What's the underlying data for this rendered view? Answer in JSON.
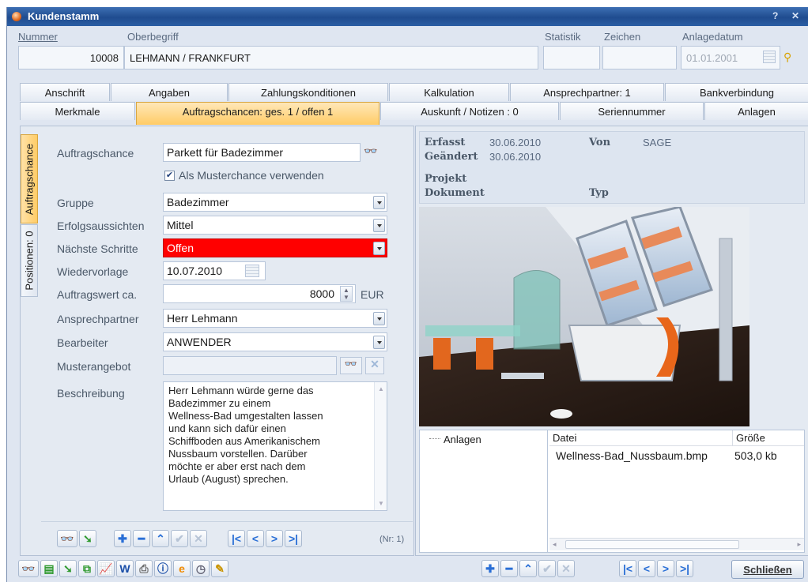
{
  "window": {
    "title": "Kundenstamm",
    "help_glyph": "?"
  },
  "header": {
    "nummer_label": "Nummer",
    "nummer_value": "10008",
    "oberbegriff_label": "Oberbegriff",
    "oberbegriff_value": "LEHMANN / FRANKFURT",
    "statistik_label": "Statistik",
    "zeichen_label": "Zeichen",
    "anlagedatum_label": "Anlagedatum",
    "anlagedatum_value": "01.01.2001"
  },
  "tabs_row1": [
    "Anschrift",
    "Angaben",
    "Zahlungskonditionen",
    "Kalkulation",
    "Ansprechpartner: 1",
    "Bankverbindung"
  ],
  "tabs_row2": [
    "Merkmale",
    "Auftragschancen: ges. 1 / offen 1",
    "Auskunft / Notizen : 0",
    "Seriennummer",
    "Anlagen"
  ],
  "side_tabs": {
    "auftragschance": "Auftragschance",
    "positionen": "Positionen: 0"
  },
  "form": {
    "auftragschance_label": "Auftragschance",
    "auftragschance_value": "Parkett für Badezimmer",
    "musterchance_label": "Als Musterchance verwenden",
    "gruppe_label": "Gruppe",
    "gruppe_value": "Badezimmer",
    "erfolg_label": "Erfolgsaussichten",
    "erfolg_value": "Mittel",
    "schritte_label": "Nächste Schritte",
    "schritte_value": "Offen",
    "wiedervorlage_label": "Wiedervorlage",
    "wiedervorlage_value": "10.07.2010",
    "auftragswert_label": "Auftragswert ca.",
    "auftragswert_value": "8000",
    "auftragswert_unit": "EUR",
    "ansprechpartner_label": "Ansprechpartner",
    "ansprechpartner_value": "Herr Lehmann",
    "bearbeiter_label": "Bearbeiter",
    "bearbeiter_value": "ANWENDER",
    "musterangebot_label": "Musterangebot",
    "beschreibung_label": "Beschreibung",
    "beschreibung_lines": [
      "Herr Lehmann würde gerne das",
      "Badezimmer zu einem",
      "Wellness-Bad umgestalten lassen",
      "und kann sich dafür einen",
      "Schiffboden aus Amerikanischem",
      "Nussbaum vorstellen. Darüber",
      "möchte er aber erst nach dem",
      "Urlaub (August) sprechen."
    ],
    "record_counter": "(Nr: 1)"
  },
  "info": {
    "erfasst_label": "Erfasst",
    "erfasst_value": "30.06.2010",
    "von_label": "Von",
    "von_value": "SAGE",
    "geaendert_label": "Geändert",
    "geaendert_value": "30.06.2010",
    "projekt_label": "Projekt",
    "dokument_label": "Dokument",
    "typ_label": "Typ"
  },
  "attachments": {
    "tree_label": "Anlagen",
    "col_datei": "Datei",
    "col_groesse": "Größe",
    "file_name": "Wellness-Bad_Nussbaum.bmp",
    "file_size": "503,0 kb"
  },
  "footer": {
    "close_label": "Schließen"
  },
  "colors": {
    "title_bar": "#2b5ea4",
    "active_tab": "#ffcc66",
    "alert_red": "#ff0000",
    "panel": "#e4eaf2"
  }
}
